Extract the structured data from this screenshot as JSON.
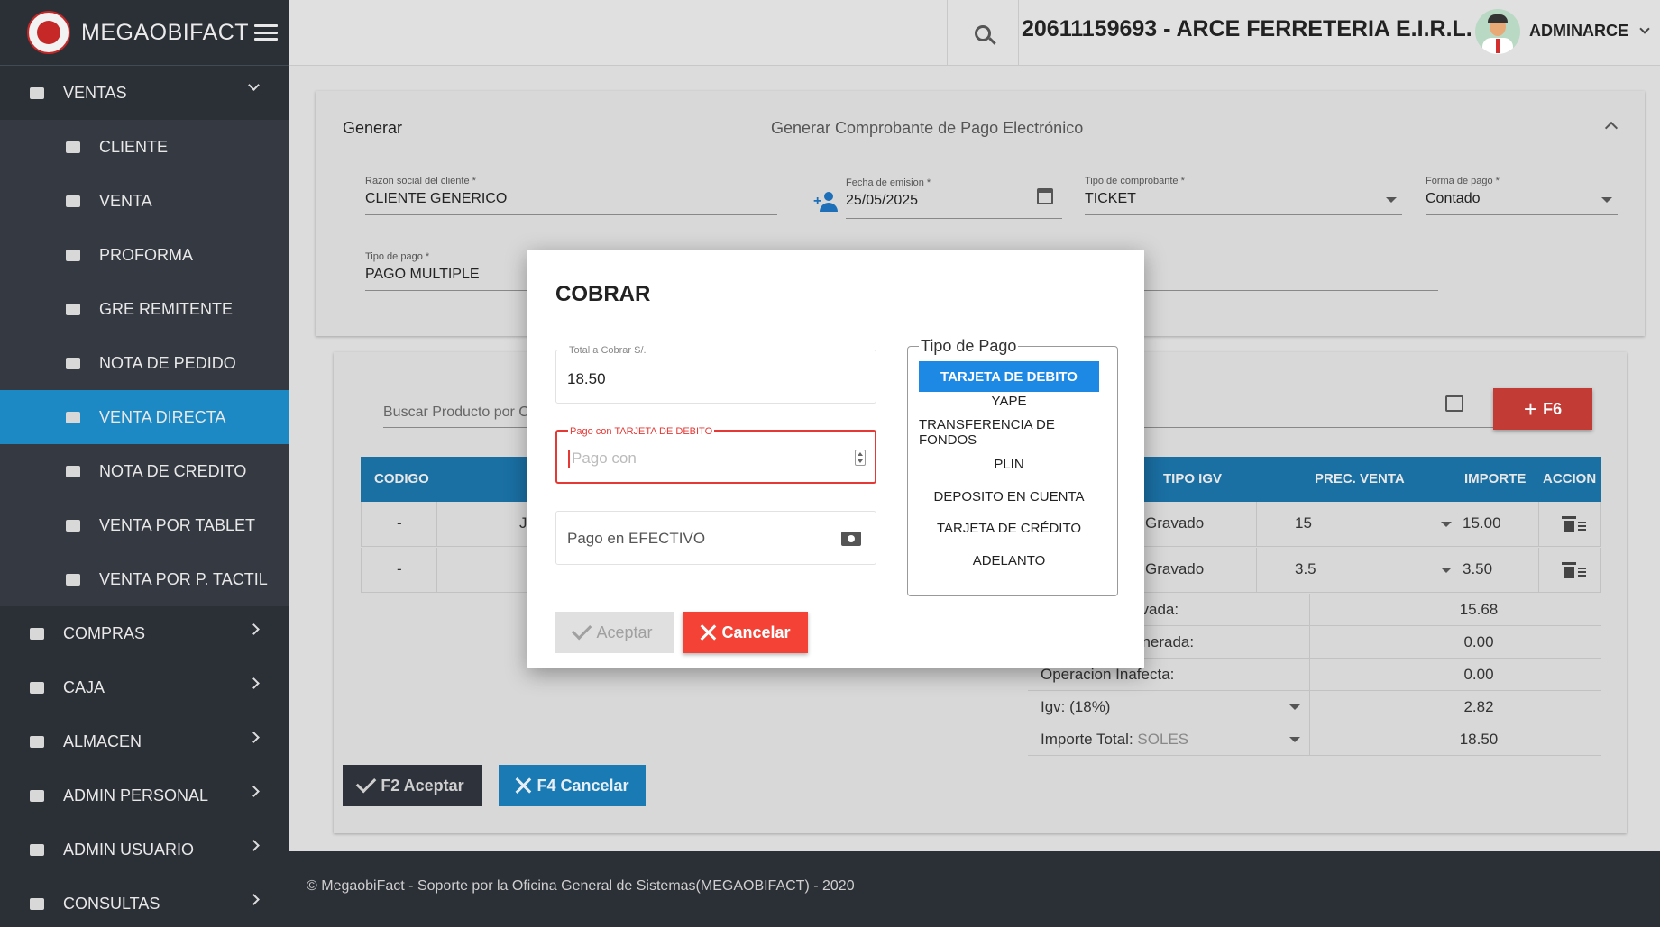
{
  "brand": {
    "name": "MEGAOBIFACT"
  },
  "topbar": {
    "company": "20611159693 - ARCE FERRETERIA E.I.R.L.",
    "username": "ADMINARCE"
  },
  "sidebar": {
    "items": [
      {
        "label": "VENTAS",
        "icon": "cart-icon"
      },
      {
        "label": "CLIENTE",
        "icon": "user-add-icon"
      },
      {
        "label": "VENTA",
        "icon": "cart-plus-icon"
      },
      {
        "label": "PROFORMA",
        "icon": "cart-plus-icon"
      },
      {
        "label": "GRE REMITENTE",
        "icon": "bus-icon"
      },
      {
        "label": "NOTA DE PEDIDO",
        "icon": "notes-icon"
      },
      {
        "label": "VENTA DIRECTA",
        "icon": "cart-icon"
      },
      {
        "label": "NOTA DE CREDITO",
        "icon": "user-voice-icon"
      },
      {
        "label": "VENTA POR TABLET",
        "icon": "tablet-icon"
      },
      {
        "label": "VENTA POR P. TACTIL",
        "icon": "touch-icon"
      },
      {
        "label": "COMPRAS",
        "icon": "truck-icon"
      },
      {
        "label": "CAJA",
        "icon": "register-icon"
      },
      {
        "label": "ALMACEN",
        "icon": "store-icon"
      },
      {
        "label": "ADMIN PERSONAL",
        "icon": "people-icon"
      },
      {
        "label": "ADMIN USUARIO",
        "icon": "laptop-icon"
      },
      {
        "label": "CONSULTAS",
        "icon": "box-icon"
      }
    ]
  },
  "form": {
    "title": "Generar",
    "subtitle": "Generar Comprobante de Pago Electrónico",
    "razon_label": "Razon social del cliente *",
    "razon_value": "CLIENTE GENERICO",
    "fecha_label": "Fecha de emision *",
    "fecha_value": "25/05/2025",
    "tipo_comp_label": "Tipo de comprobante *",
    "tipo_comp_value": "TICKET",
    "forma_label": "Forma de pago *",
    "forma_value": "Contado",
    "tipo_pago_label": "Tipo de pago *",
    "tipo_pago_value": "PAGO MULTIPLE"
  },
  "products": {
    "search_placeholder": "Buscar Producto por C",
    "f6_label": "F6",
    "headers": {
      "codigo": "CODIGO",
      "tipo_igv": "TIPO IGV",
      "prec_venta": "PREC. VENTA",
      "importe": "IMPORTE",
      "accion": "ACCION"
    },
    "rows": [
      {
        "codigo": "-",
        "desc": "J",
        "tipo_igv": "Gravado",
        "precio": "15",
        "importe": "15.00"
      },
      {
        "codigo": "-",
        "desc": "",
        "tipo_igv": "Gravado",
        "precio": "3.5",
        "importe": "3.50"
      }
    ],
    "summary": [
      {
        "label": "Operacion Gravada:",
        "value": "15.68"
      },
      {
        "label": "Operacion Exonerada:",
        "value": "0.00"
      },
      {
        "label": "Operacion Inafecta:",
        "value": "0.00"
      },
      {
        "label": "Igv: (18%)",
        "value": "2.82"
      },
      {
        "label": "Importe Total:",
        "extra": "SOLES",
        "value": "18.50"
      }
    ],
    "btn_accept": "F2 Aceptar",
    "btn_cancel": "F4 Cancelar"
  },
  "footer": {
    "text": "© MegaobiFact - Soporte por la Oficina General de Sistemas(MEGAOBIFACT) - 2020"
  },
  "modal": {
    "title": "COBRAR",
    "total_label": "Total a Cobrar S/.",
    "total_value": "18.50",
    "pago_label": "Pago con TARJETA DE DEBITO",
    "pago_placeholder": "Pago con",
    "efectivo_placeholder": "Pago en EFECTIVO",
    "tipo_legend": "Tipo de Pago",
    "tipos": [
      "TARJETA DE DEBITO",
      "YAPE",
      "TRANSFERENCIA DE FONDOS",
      "PLIN",
      "DEPOSITO EN CUENTA",
      "TARJETA DE CRÉDITO",
      "ADELANTO"
    ],
    "selected_tipo": "TARJETA DE DEBITO",
    "accept_label": "Aceptar",
    "cancel_label": "Cancelar"
  },
  "colors": {
    "sidebar_bg": "#2b2f36",
    "active_item": "#1c88c4",
    "table_header": "#1a6fa3",
    "danger": "#f44336",
    "selected_tipo": "#1e88e5"
  }
}
